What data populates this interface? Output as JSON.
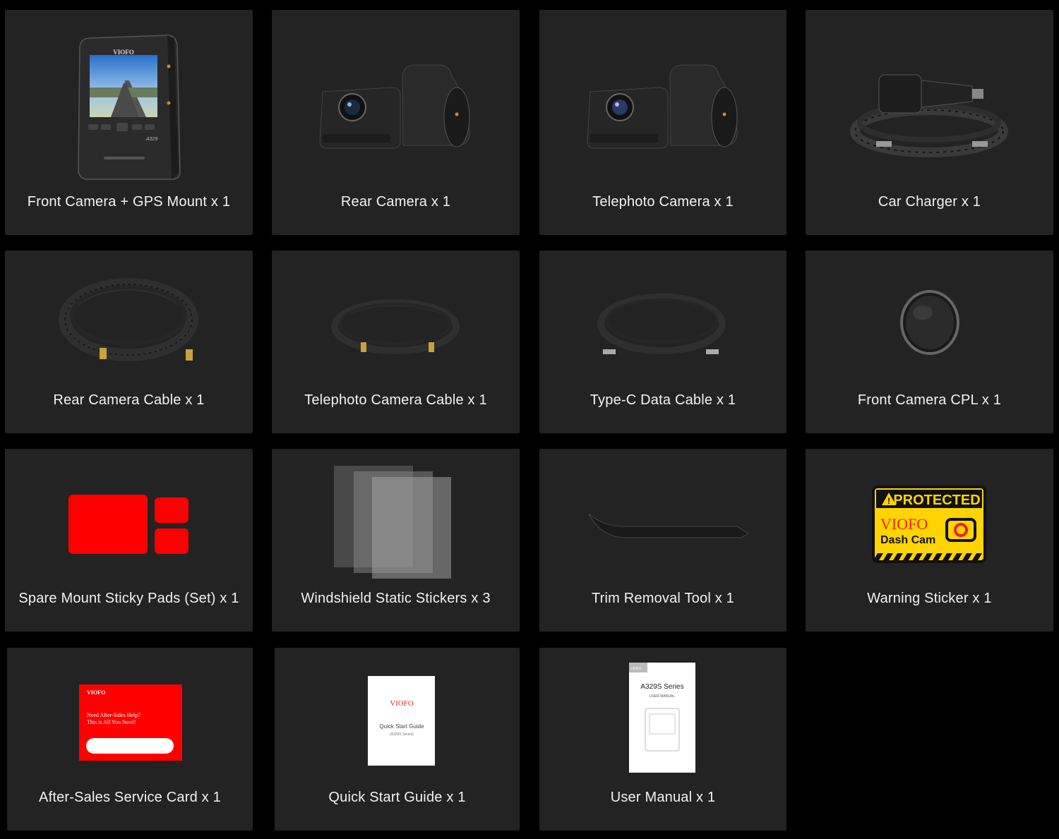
{
  "items": [
    {
      "label": "Front Camera + GPS Mount x 1",
      "icon": "dashcam-front-icon"
    },
    {
      "label": "Rear Camera x 1",
      "icon": "rear-camera-icon"
    },
    {
      "label": "Telephoto Camera x 1",
      "icon": "telephoto-camera-icon"
    },
    {
      "label": "Car Charger x 1",
      "icon": "car-charger-icon"
    },
    {
      "label": "Rear Camera Cable x 1",
      "icon": "coiled-cable-icon"
    },
    {
      "label": "Telephoto Camera Cable x 1",
      "icon": "coiled-cable-icon"
    },
    {
      "label": "Type-C Data Cable x 1",
      "icon": "usb-c-cable-icon"
    },
    {
      "label": "Front Camera CPL x 1",
      "icon": "cpl-filter-icon"
    },
    {
      "label": "Spare Mount Sticky Pads (Set) x 1",
      "icon": "sticky-pads-icon"
    },
    {
      "label": "Windshield Static Stickers x 3",
      "icon": "static-stickers-icon"
    },
    {
      "label": "Trim Removal Tool x 1",
      "icon": "trim-tool-icon"
    },
    {
      "label": "Warning Sticker x 1",
      "icon": "warning-sticker-icon"
    },
    {
      "label": "After-Sales Service Card x 1",
      "icon": "service-card-icon"
    },
    {
      "label": "Quick Start Guide x 1",
      "icon": "quick-start-guide-icon"
    },
    {
      "label": "User Manual x 1",
      "icon": "user-manual-icon"
    }
  ],
  "camera": {
    "brand": "VIOFO",
    "model": "A329"
  },
  "warning_sticker": {
    "headline": "PROTECTED",
    "brand": "VIOFO",
    "subtitle": "Dash Cam"
  },
  "service_card": {
    "brand": "VIOFO",
    "line1": "Need After-Sales Help?",
    "line2": "This is All You Need!"
  },
  "quick_start": {
    "brand": "VIOFO",
    "title": "Quick Start Guide",
    "subtitle": "(A329S Series)"
  },
  "user_manual": {
    "brand": "VIOFO",
    "title": "A329S Series",
    "subtitle": "USER MANUAL"
  },
  "colors": {
    "background": "#000000",
    "card": "#232323",
    "text": "#f2f2f2",
    "accent_red": "#ff0000",
    "sticker_yellow": "#ffd400"
  }
}
